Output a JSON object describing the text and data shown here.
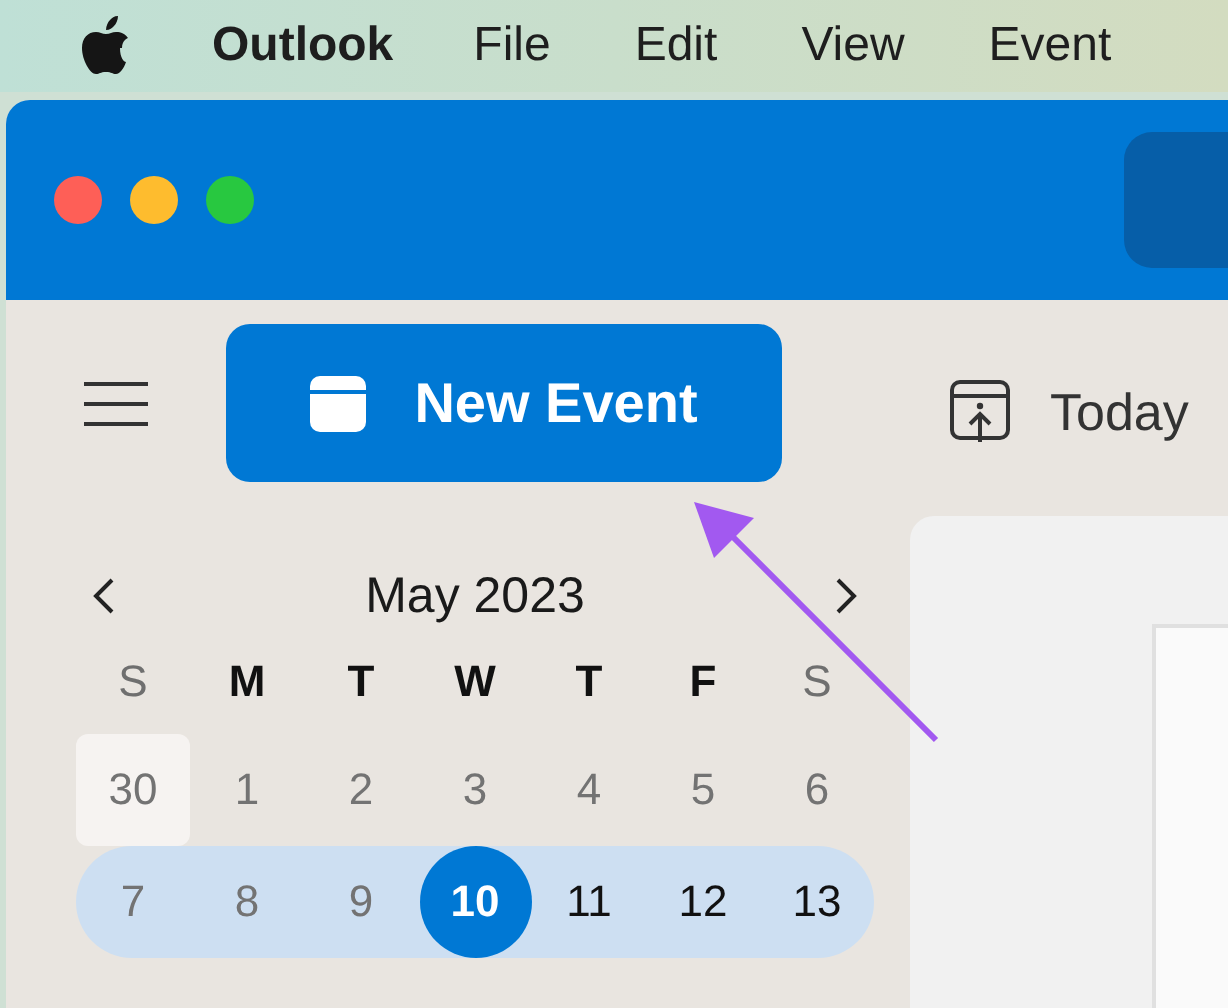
{
  "menu_bar": {
    "app_name": "Outlook",
    "items": [
      "File",
      "Edit",
      "View",
      "Event"
    ]
  },
  "toolbar": {
    "new_event": "New Event",
    "today": "Today"
  },
  "mini_calendar": {
    "title": "May 2023",
    "weekdays": [
      {
        "label": "S",
        "weekend": true
      },
      {
        "label": "M",
        "weekend": false
      },
      {
        "label": "T",
        "weekend": false
      },
      {
        "label": "W",
        "weekend": false
      },
      {
        "label": "T",
        "weekend": false
      },
      {
        "label": "F",
        "weekend": false
      },
      {
        "label": "S",
        "weekend": true
      }
    ],
    "weeks": [
      {
        "selected": false,
        "days": [
          {
            "label": "30",
            "muted": true,
            "other_month": true,
            "today": false
          },
          {
            "label": "1",
            "muted": true,
            "other_month": false,
            "today": false
          },
          {
            "label": "2",
            "muted": true,
            "other_month": false,
            "today": false
          },
          {
            "label": "3",
            "muted": true,
            "other_month": false,
            "today": false
          },
          {
            "label": "4",
            "muted": true,
            "other_month": false,
            "today": false
          },
          {
            "label": "5",
            "muted": true,
            "other_month": false,
            "today": false
          },
          {
            "label": "6",
            "muted": true,
            "other_month": false,
            "today": false
          }
        ]
      },
      {
        "selected": true,
        "days": [
          {
            "label": "7",
            "muted": true,
            "other_month": false,
            "today": false
          },
          {
            "label": "8",
            "muted": true,
            "other_month": false,
            "today": false
          },
          {
            "label": "9",
            "muted": true,
            "other_month": false,
            "today": false
          },
          {
            "label": "10",
            "muted": false,
            "other_month": false,
            "today": true
          },
          {
            "label": "11",
            "muted": false,
            "other_month": false,
            "today": false
          },
          {
            "label": "12",
            "muted": false,
            "other_month": false,
            "today": false
          },
          {
            "label": "13",
            "muted": false,
            "other_month": false,
            "today": false
          }
        ]
      }
    ]
  }
}
